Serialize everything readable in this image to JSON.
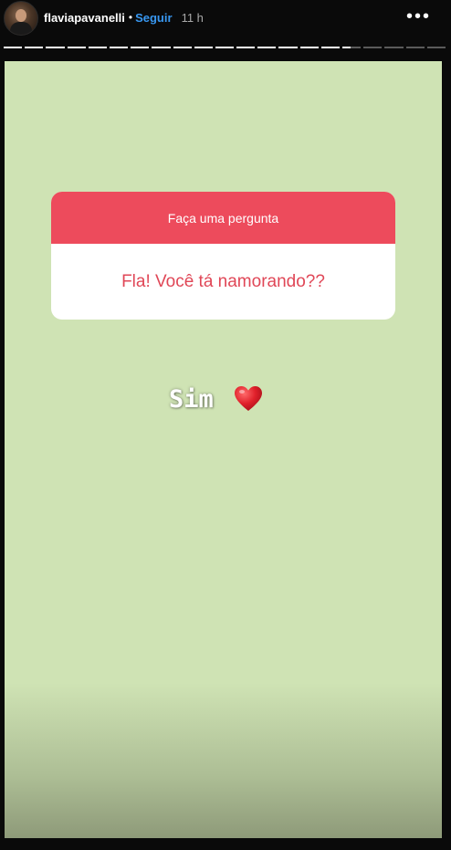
{
  "header": {
    "username": "flaviapavanelli",
    "separator": "•",
    "follow_label": "Seguir",
    "time": "11 h",
    "more_icon": "•••"
  },
  "progress": {
    "segments_done": 16,
    "segments_total": 21,
    "active_fill": 0.45
  },
  "question_sticker": {
    "title": "Faça uma pergunta",
    "question": "Fla! Você tá namorando??",
    "header_color": "#ed4b5c",
    "text_color": "#e04757"
  },
  "answer": {
    "text": "Sim",
    "emoji_icon": "red-heart-icon"
  },
  "colors": {
    "story_background": "#cfe3b4",
    "follow_blue": "#3897f0"
  }
}
